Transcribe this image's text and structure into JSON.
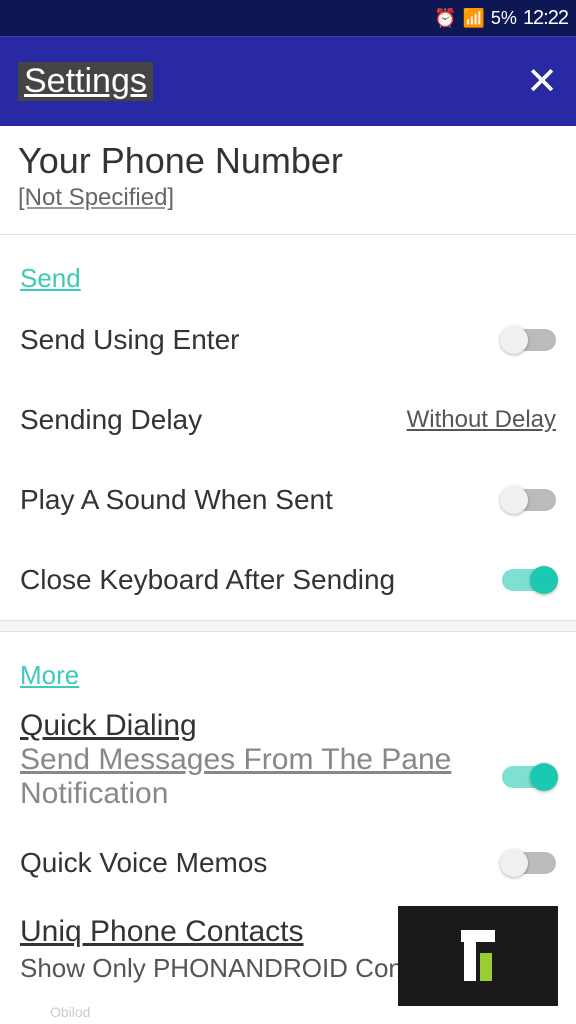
{
  "status_bar": {
    "battery": "5%",
    "time": "12:22"
  },
  "header": {
    "title": "Settings"
  },
  "phone": {
    "title": "Your Phone Number",
    "subtitle": "[Not Specified]"
  },
  "sections": {
    "send": {
      "header": "Send",
      "send_enter": "Send Using Enter",
      "sending_delay": "Sending Delay",
      "sending_delay_value": "Without Delay",
      "play_sound": "Play A Sound When Sent",
      "close_keyboard": "Close Keyboard After Sending"
    },
    "more": {
      "header": "More",
      "quick_dialing": "Quick Dialing",
      "send_from_pane": "Send Messages From The Pane",
      "notification": "Notification",
      "quick_voice": "Quick Voice Memos",
      "uniq_contacts": "Uniq Phone Contacts",
      "show_only": "Show Only PHONANDROID Contacts"
    }
  },
  "watermark": "Obilod"
}
